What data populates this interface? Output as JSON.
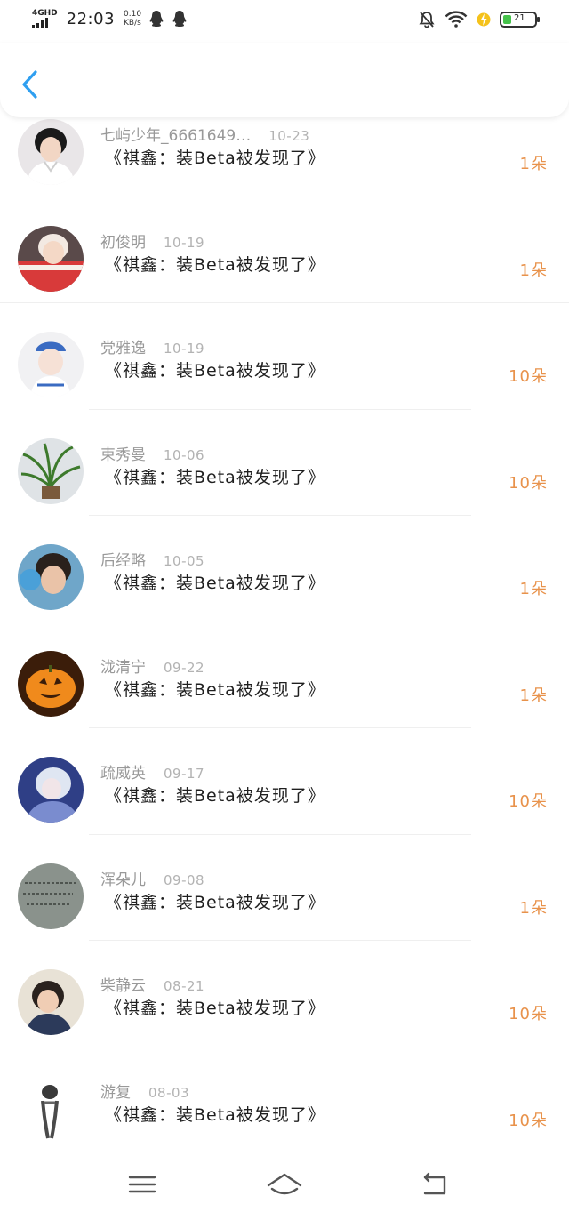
{
  "status_bar": {
    "network": "4GHD",
    "time": "22:03",
    "speed_value": "0.10",
    "speed_unit": "KB/s",
    "battery_level": "21",
    "icons": [
      "qq-icon",
      "qq-icon",
      "mute-icon",
      "wifi-icon",
      "charging-icon",
      "battery-icon"
    ]
  },
  "header": {
    "back_icon": "chevron-left-icon",
    "accent_color": "#2f9ff0"
  },
  "list": {
    "count_color": "#e8924b",
    "items": [
      {
        "name": "七屿少年_6661649…",
        "date": "10-23",
        "title": "《祺鑫：装Beta被发现了》",
        "count": "1朵"
      },
      {
        "name": "初俊明",
        "date": "10-19",
        "title": "《祺鑫：装Beta被发现了》",
        "count": "1朵"
      },
      {
        "name": "党雅逸",
        "date": "10-19",
        "title": "《祺鑫：装Beta被发现了》",
        "count": "10朵"
      },
      {
        "name": "束秀曼",
        "date": "10-06",
        "title": "《祺鑫：装Beta被发现了》",
        "count": "10朵"
      },
      {
        "name": "后经略",
        "date": "10-05",
        "title": "《祺鑫：装Beta被发现了》",
        "count": "1朵"
      },
      {
        "name": "泷清宁",
        "date": "09-22",
        "title": "《祺鑫：装Beta被发现了》",
        "count": "1朵"
      },
      {
        "name": "疏威英",
        "date": "09-17",
        "title": "《祺鑫：装Beta被发现了》",
        "count": "10朵"
      },
      {
        "name": "浑朵儿",
        "date": "09-08",
        "title": "《祺鑫：装Beta被发现了》",
        "count": "1朵"
      },
      {
        "name": "柴静云",
        "date": "08-21",
        "title": "《祺鑫：装Beta被发现了》",
        "count": "10朵"
      },
      {
        "name": "游复",
        "date": "08-03",
        "title": "《祺鑫：装Beta被发现了》",
        "count": "10朵"
      }
    ]
  },
  "nav_bar": {
    "icons": [
      "menu-icon",
      "home-icon",
      "back-icon"
    ]
  }
}
